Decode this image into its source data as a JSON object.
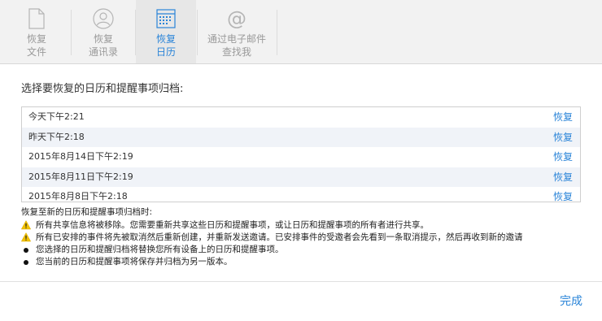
{
  "toolbar": {
    "items": [
      {
        "line1": "恢复",
        "line2": "文件"
      },
      {
        "line1": "恢复",
        "line2": "通讯录"
      },
      {
        "line1": "恢复",
        "line2": "日历"
      },
      {
        "line1": "通过电子邮件",
        "line2": "查找我"
      }
    ],
    "active_index": 2
  },
  "main": {
    "title": "选择要恢复的日历和提醒事项归档:",
    "archives": [
      {
        "date": "今天下午2:21",
        "action": "恢复"
      },
      {
        "date": "昨天下午2:18",
        "action": "恢复"
      },
      {
        "date": "2015年8月14日下午2:19",
        "action": "恢复"
      },
      {
        "date": "2015年8月11日下午2:19",
        "action": "恢复"
      },
      {
        "date": "2015年8月8日下午2:18",
        "action": "恢复"
      }
    ]
  },
  "notes": {
    "heading": "恢复至新的日历和提醒事项归档时:",
    "items": [
      {
        "icon": "warning-icon",
        "text": "所有共享信息将被移除。您需要重新共享这些日历和提醒事项，或让日历和提醒事项的所有者进行共享。"
      },
      {
        "icon": "warning-icon",
        "text": "所有已安排的事件将先被取消然后重新创建，并重新发送邀请。已安排事件的受邀者会先看到一条取消提示，然后再收到新的邀请"
      },
      {
        "icon": "bullet-icon",
        "text": "您选择的日历和提醒归档将替换您所有设备上的日历和提醒事项。"
      },
      {
        "icon": "bullet-icon",
        "text": "您当前的日历和提醒事项将保存并归档为另一版本。"
      }
    ]
  },
  "footer": {
    "done_label": "完成"
  },
  "colors": {
    "accent": "#2a84d8",
    "warning": "#f2c200"
  }
}
